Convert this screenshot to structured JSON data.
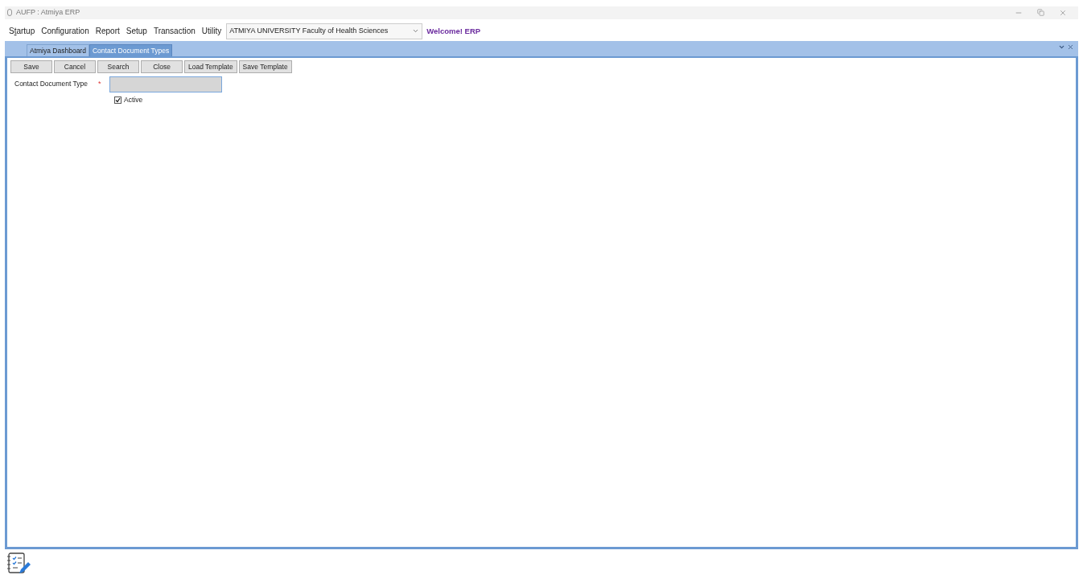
{
  "window": {
    "title": "AUFP : Atmiya ERP"
  },
  "menu": [
    {
      "label_before": "S",
      "hotkey": "t",
      "label_after": "artup"
    },
    {
      "label": "Configuration"
    },
    {
      "label": "Report"
    },
    {
      "label": "Setup"
    },
    {
      "label": "Transaction"
    },
    {
      "label": "Utility"
    }
  ],
  "institution_select": {
    "value": "ATMIYA UNIVERSITY Faculty of Health Sciences"
  },
  "welcome": "Welcome! ERP",
  "tabs": [
    {
      "label": "Atmiya Dashboard",
      "selected": false
    },
    {
      "label": "Contact Document Types",
      "selected": true
    }
  ],
  "toolbar": [
    "Save",
    "Cancel",
    "Search",
    "Close",
    "Load Template",
    "Save Template"
  ],
  "form": {
    "field_label": "Contact Document Type",
    "required_mark": "*",
    "active": {
      "label": "Active",
      "checked": true
    }
  }
}
